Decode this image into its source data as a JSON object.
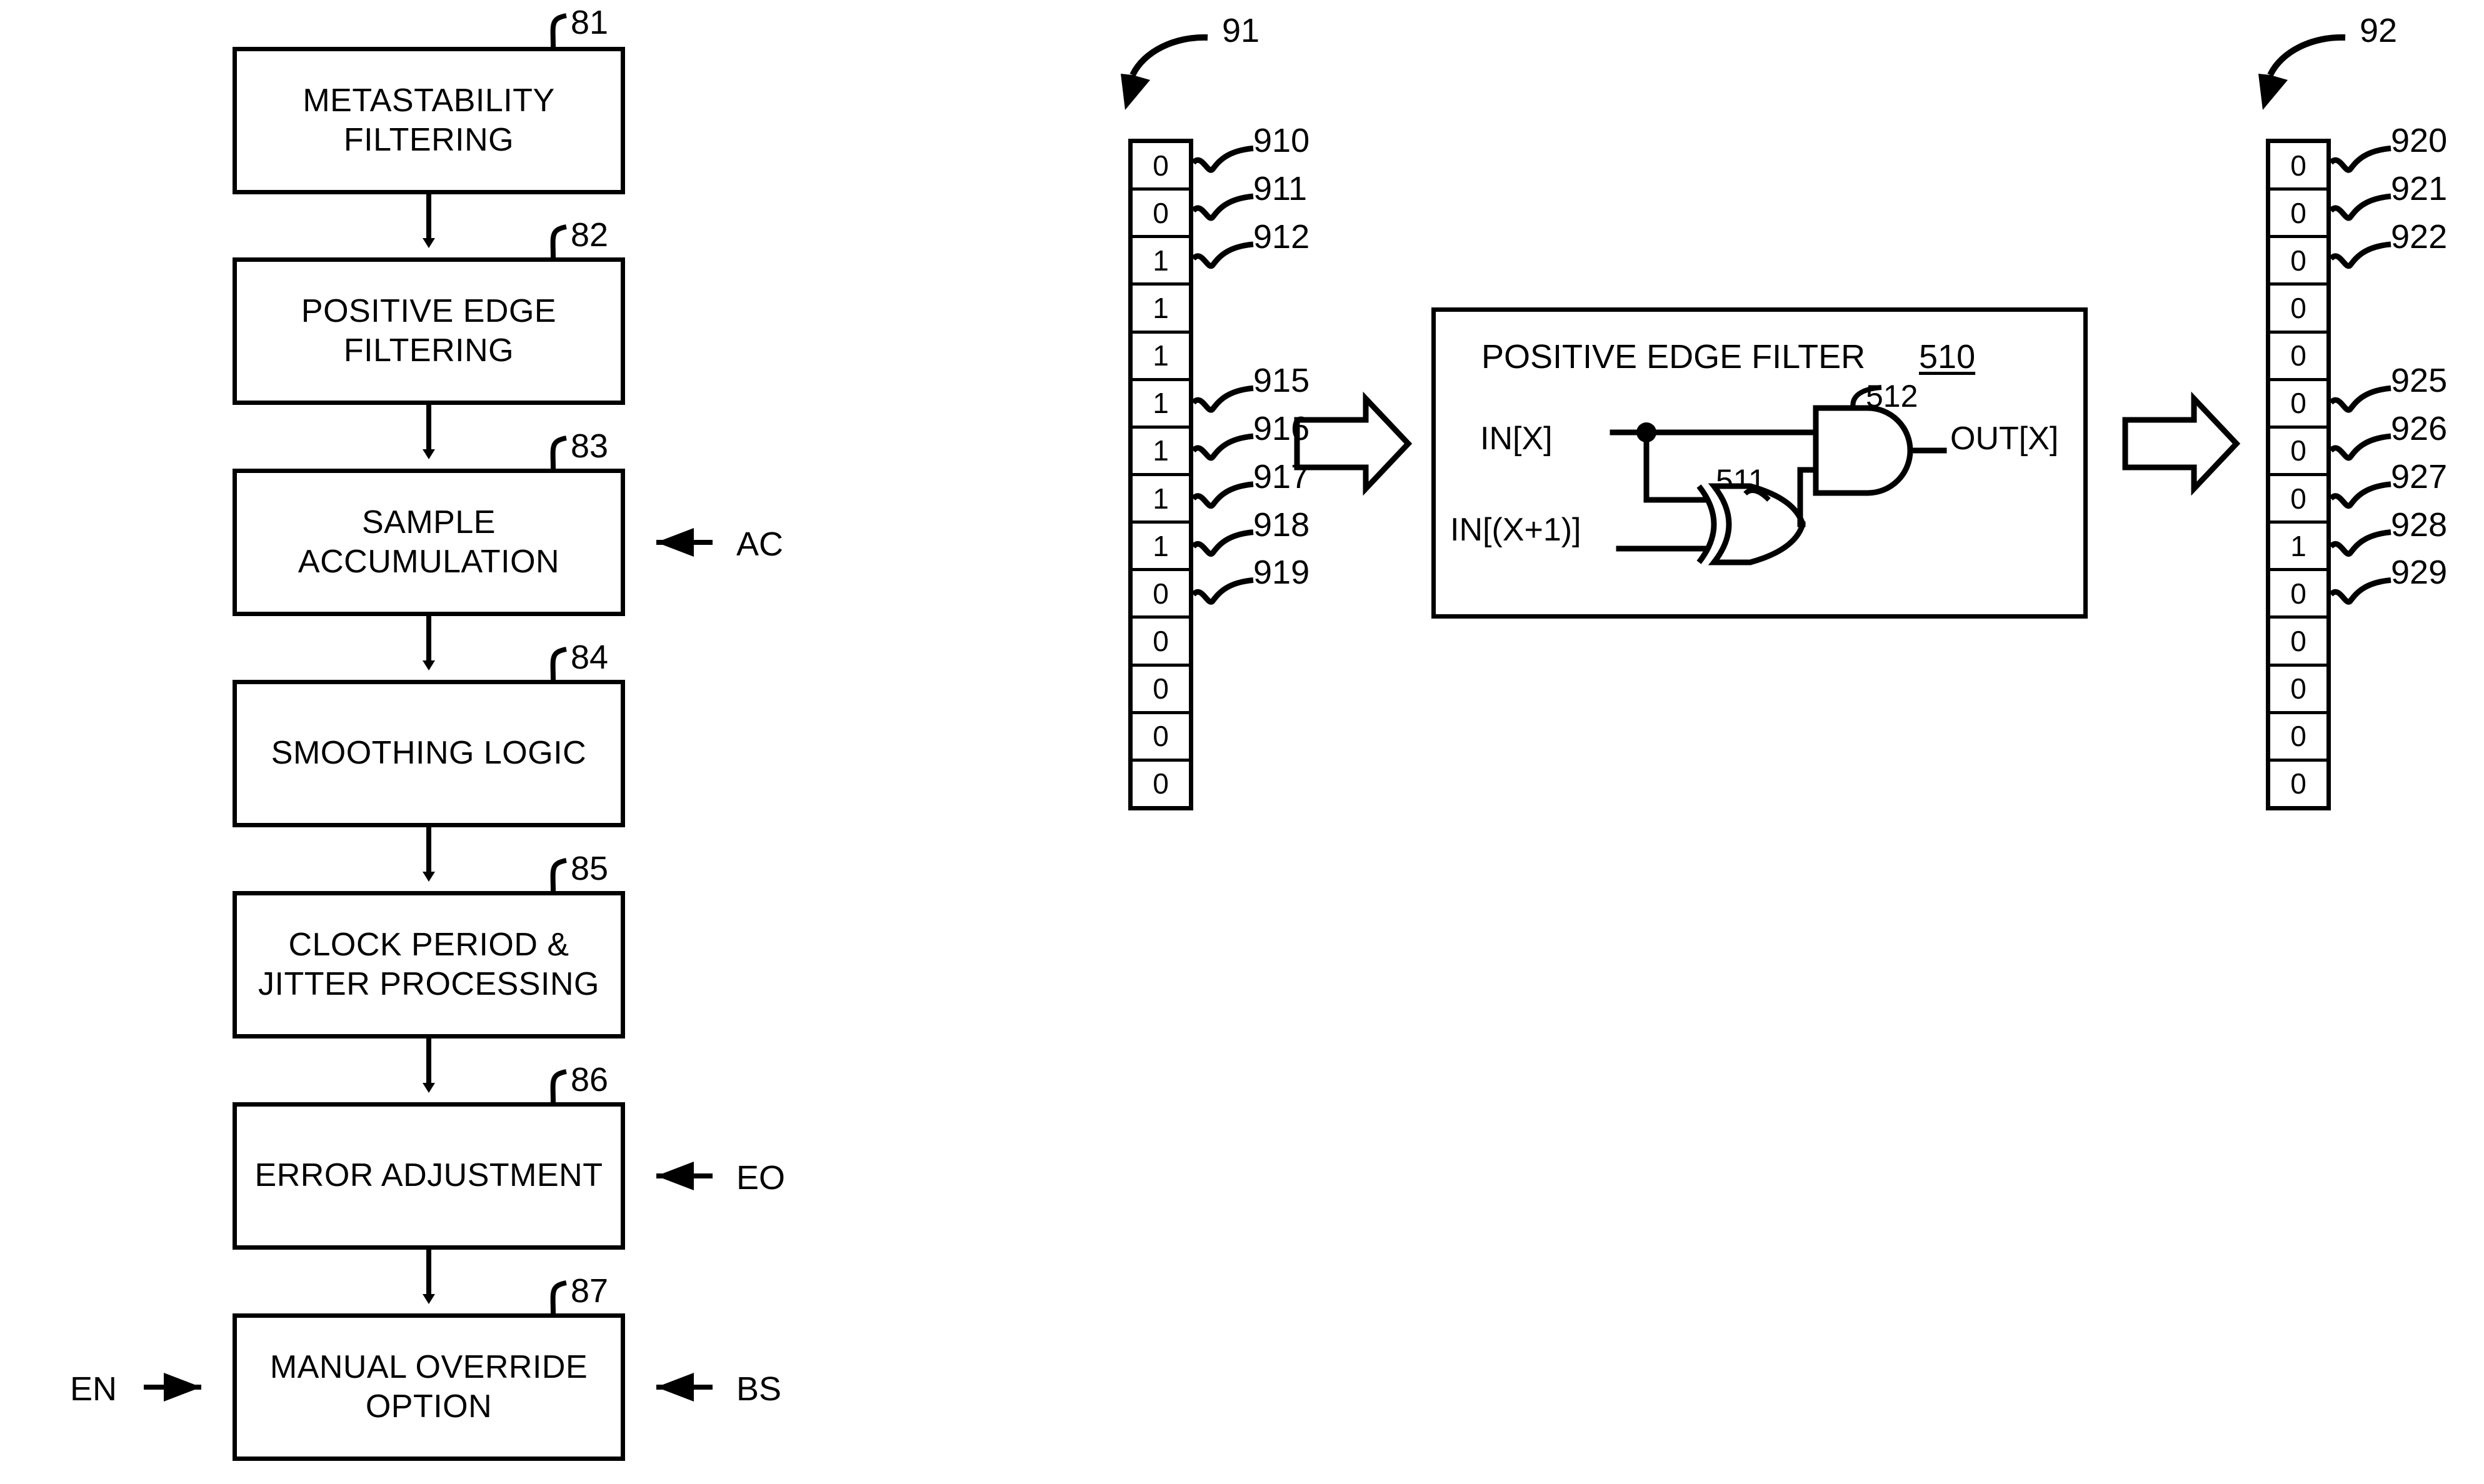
{
  "figure": {
    "title": "Clock measurement processing flow with positive edge filter",
    "line_color": "#000000",
    "background_color": "#ffffff"
  },
  "flowchart": {
    "ref_91_label": "91",
    "steps": [
      {
        "ref": "81",
        "line1": "METASTABILITY",
        "line2": "FILTERING"
      },
      {
        "ref": "82",
        "line1": "POSITIVE EDGE",
        "line2": "FILTERING"
      },
      {
        "ref": "83",
        "line1": "SAMPLE",
        "line2": "ACCUMULATION"
      },
      {
        "ref": "84",
        "line1": "SMOOTHING LOGIC",
        "line2": ""
      },
      {
        "ref": "85",
        "line1": "CLOCK PERIOD &",
        "line2": "JITTER PROCESSING"
      },
      {
        "ref": "86",
        "line1": "ERROR ADJUSTMENT",
        "line2": ""
      },
      {
        "ref": "87",
        "line1": "MANUAL OVERRIDE",
        "line2": "OPTION"
      }
    ],
    "side_inputs": [
      {
        "name": "AC",
        "target_ref": "83",
        "side": "right"
      },
      {
        "name": "EO",
        "target_ref": "86",
        "side": "right"
      },
      {
        "name": "EN",
        "target_ref": "87",
        "side": "left"
      },
      {
        "name": "BS",
        "target_ref": "87",
        "side": "right"
      }
    ]
  },
  "input_array": {
    "ref": "91",
    "bits": [
      "0",
      "0",
      "1",
      "1",
      "1",
      "1",
      "1",
      "1",
      "1",
      "0",
      "0",
      "0",
      "0",
      "0"
    ],
    "cell_refs": [
      "910",
      "911",
      "912",
      "",
      "",
      "915",
      "916",
      "917",
      "918",
      "919",
      "",
      "",
      "",
      ""
    ]
  },
  "output_array": {
    "ref": "92",
    "bits": [
      "0",
      "0",
      "0",
      "0",
      "0",
      "0",
      "0",
      "0",
      "1",
      "0",
      "0",
      "0",
      "0",
      "0"
    ],
    "cell_refs": [
      "920",
      "921",
      "922",
      "",
      "",
      "925",
      "926",
      "927",
      "928",
      "929",
      "",
      "",
      "",
      ""
    ]
  },
  "filter_block": {
    "title": "POSITIVE EDGE FILTER",
    "ref": "510",
    "xor_gate_ref": "511",
    "and_gate_ref": "512",
    "input_a_label": "IN[X]",
    "input_b_label": "IN[(X+1)]",
    "output_label": "OUT[X]"
  }
}
